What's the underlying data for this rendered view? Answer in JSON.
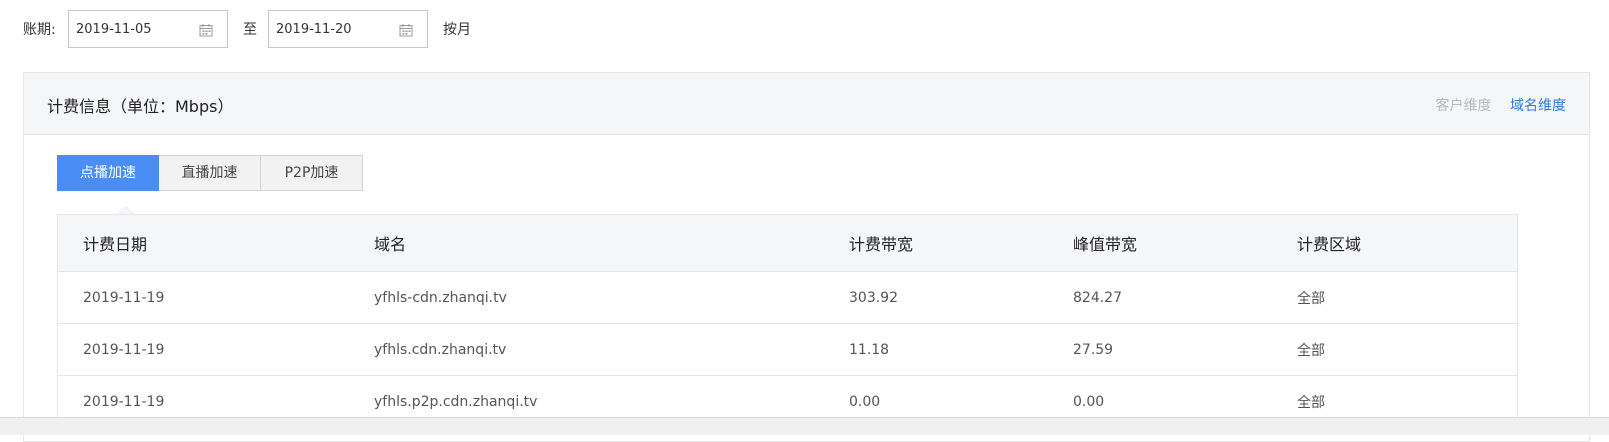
{
  "filter": {
    "label": "账期:",
    "start_date": "2019-11-05",
    "separator": "至",
    "end_date": "2019-11-20",
    "month_button": "按月",
    "calendar_icon": "calendar-icon"
  },
  "panel": {
    "title": "计费信息（单位：Mbps）",
    "dimension_switch": {
      "customer": "客户维度",
      "domain": "域名维度",
      "active": "域名维度"
    }
  },
  "tabs": [
    {
      "label": "点播加速",
      "active": true
    },
    {
      "label": "直播加速",
      "active": false
    },
    {
      "label": "P2P加速",
      "active": false
    }
  ],
  "table": {
    "columns": [
      "计费日期",
      "域名",
      "计费带宽",
      "峰值带宽",
      "计费区域"
    ],
    "rows": [
      [
        "2019-11-19",
        "yfhls-cdn.zhanqi.tv",
        "303.92",
        "824.27",
        "全部"
      ],
      [
        "2019-11-19",
        "yfhls.cdn.zhanqi.tv",
        "11.18",
        "27.59",
        "全部"
      ],
      [
        "2019-11-19",
        "yfhls.p2p.cdn.zhanqi.tv",
        "0.00",
        "0.00",
        "全部"
      ]
    ]
  },
  "colors": {
    "accent": "#2d7be5",
    "tab_active_bg": "#4a8ef5",
    "header_bg": "#f5f6f8"
  }
}
